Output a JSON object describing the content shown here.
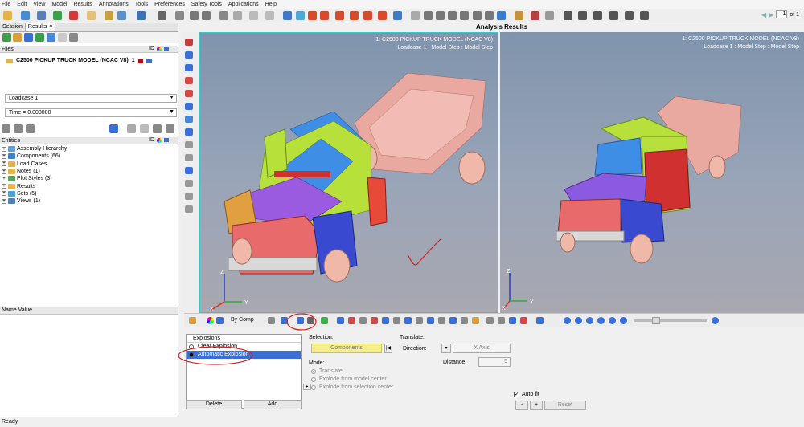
{
  "menu": [
    "File",
    "Edit",
    "View",
    "Model",
    "Results",
    "Annotations",
    "Tools",
    "Preferences",
    "Safety Tools",
    "Applications",
    "Help"
  ],
  "page_control": {
    "current": "1",
    "total_label": "of 1"
  },
  "tabs": [
    {
      "label": "Session",
      "active": false
    },
    {
      "label": "Results",
      "active": true,
      "close": "×"
    }
  ],
  "files": {
    "header": "Files",
    "columns": [
      "ID"
    ],
    "row": {
      "name": "C2500 PICKUP TRUCK MODEL (NCAC V8)",
      "id": "1"
    }
  },
  "loadcase": "Loadcase 1",
  "time": "Time = 0.000000",
  "entities": {
    "header": "Entities",
    "columns": [
      "ID"
    ],
    "items": [
      {
        "label": "Assembly Hierarchy",
        "color": "#6a9bd1"
      },
      {
        "label": "Components (66)",
        "color": "#3a7fd0"
      },
      {
        "label": "Load Cases",
        "color": "#e2b44a"
      },
      {
        "label": "Notes (1)",
        "color": "#e2b44a"
      },
      {
        "label": "Plot Styles (3)",
        "color": "#5aa55a"
      },
      {
        "label": "Results",
        "color": "#e2b44a"
      },
      {
        "label": "Sets (5)",
        "color": "#49a0d4"
      },
      {
        "label": "Views (1)",
        "color": "#4a7fc0"
      }
    ]
  },
  "name_value": {
    "name": "Name",
    "value": "Value"
  },
  "status": "Ready",
  "title": "Analysis Results",
  "viewports": [
    {
      "line1": "1: C2500 PICKUP TRUCK MODEL (NCAC V8)",
      "line2": "Loadcase 1 : Model Step : Model Step"
    },
    {
      "line1": "1: C2500 PICKUP TRUCK MODEL (NCAC V8)",
      "line2": "Loadcase 1 : Model Step : Model Step"
    }
  ],
  "axes": {
    "x": "X",
    "y": "Y",
    "z": "Z"
  },
  "bottom_toolbar": {
    "by_comp": "By Comp"
  },
  "explosions": {
    "header": "Explosions",
    "options": [
      {
        "label": "Clear Explosion",
        "selected": false
      },
      {
        "label": "Automatic Explosion",
        "selected": true
      }
    ],
    "delete": "Delete",
    "add": "Add"
  },
  "selection": {
    "label": "Selection:",
    "components": "Components"
  },
  "mode": {
    "label": "Mode:",
    "options": [
      "Translate",
      "Explode from model center",
      "Explode from selection center"
    ],
    "selected": 0
  },
  "translate": {
    "label": "Translate:",
    "direction_label": "Direction:",
    "direction_value": "X Axis",
    "distance_label": "Distance:",
    "distance_value": "5"
  },
  "autofit": {
    "label": "Auto fit",
    "checked": true,
    "minus": "-",
    "plus": "+",
    "reset": "Reset"
  },
  "colors": {
    "annotation": "#d22020",
    "viewport_border": "#3ec4c4",
    "selected": "#3a6fd6",
    "components_button": "#f4ef8c"
  }
}
